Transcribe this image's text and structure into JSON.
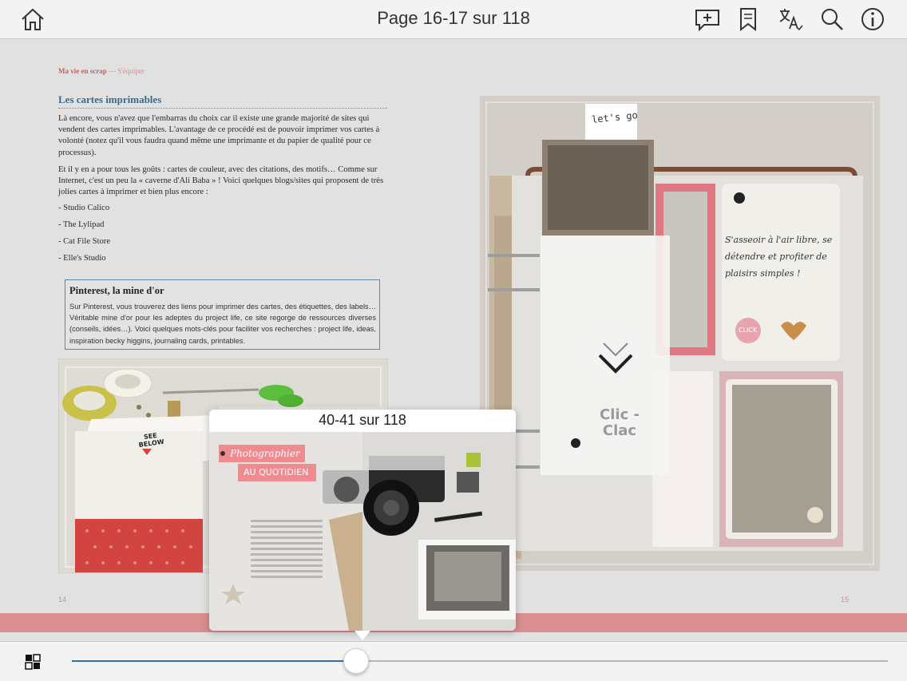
{
  "toolbar": {
    "title": "Page 16-17 sur 118",
    "icons": [
      "home-icon",
      "add-note-icon",
      "bookmark-icon",
      "translate-icon",
      "search-icon",
      "info-icon"
    ]
  },
  "left_page": {
    "running_head_book": "Ma vie en scrap",
    "running_head_section": " — S'équiper",
    "section_title": "Les cartes imprimables",
    "paragraph_1": "Là encore, vous n'avez que l'embarras du choix car il existe une grande majorité de sites qui vendent des cartes imprimables. L'avantage de ce procédé est de pouvoir imprimer vos cartes à volonté (notez qu'il vous faudra quand même une imprimante et du papier de qualité pour ce processus).",
    "paragraph_2": "Et il y en a pour tous les goûts : cartes de couleur, avec des citations, des motifs… Comme sur Internet, c'est un peu la « caverne d'Ali Baba » ! Voici quelques blogs/sites qui proposent de très jolies cartes à imprimer et bien plus encore :",
    "list": [
      "- Studio Calico",
      "- The Lylipad",
      "- Cat File Store",
      "- Elle's Studio"
    ],
    "box_title": "Pinterest, la mine d'or",
    "box_text": "Sur Pinterest, vous trouverez des liens pour imprimer des cartes, des étiquettes, des labels… Véritable mine d'or pour les adeptes du project life, ce site regorge de ressources diverses (conseils, idées…). Voici quelques mots-clés pour faciliter vos recherches : project life, ideas, inspiration becky higgins, journaling cards, printables.",
    "photo_text": "SEE BELOW",
    "page_number": "14"
  },
  "right_page": {
    "page_number": "15",
    "photo_text_lets_go": "let's go",
    "photo_text_journal": "S'asseoir à l'air libre, se détendre et profiter de plaisirs simples !",
    "photo_text_clic": "Clic - Clac",
    "photo_text_click": "CLICK"
  },
  "preview": {
    "label": "40-41 sur 118",
    "heading_1": "Photographier",
    "heading_2": "AU QUOTIDIEN"
  },
  "slider": {
    "progress": 0.347
  },
  "colors": {
    "accent": "#2f6fb2",
    "pink_band": "#d98f91",
    "section_title": "#3c6a8a"
  }
}
